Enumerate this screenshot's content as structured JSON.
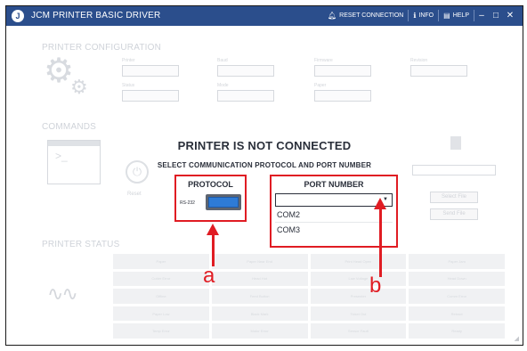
{
  "titlebar": {
    "title": "JCM PRINTER BASIC DRIVER",
    "logo_icon": "jcm-logo-icon",
    "actions": [
      {
        "label": "RESET CONNECTION",
        "icon": "bell-icon"
      },
      {
        "label": "INFO",
        "icon": "info-icon"
      },
      {
        "label": "HELP",
        "icon": "help-book-icon"
      }
    ],
    "window_controls": [
      "minimize-icon",
      "maximize-icon",
      "close-icon"
    ]
  },
  "background": {
    "printer_configuration": {
      "title": "PRINTER CONFIGURATION",
      "field_labels": [
        "Printer",
        "Baud",
        "Firmware",
        "Revision",
        "Status",
        "Mode",
        "Paper"
      ]
    },
    "commands": {
      "title": "COMMANDS",
      "reset_label": "Reset",
      "file_buttons": [
        "Select File",
        "Send File"
      ]
    },
    "printer_status": {
      "title": "PRINTER STATUS",
      "cells": [
        "Paper",
        "Paper Near End",
        "Print Head Open",
        "Paper Jam",
        "Cutter Error",
        "Head Hot",
        "Low Voltage",
        "Head Down",
        "Offline",
        "Feed Button",
        "Presenter",
        "Comm Error",
        "Paper Low",
        "Black Mark",
        "Ticket Out",
        "Retract",
        "Temp Error",
        "Motor Error",
        "Sensor Fault",
        "Ready"
      ]
    }
  },
  "dialog": {
    "title": "PRINTER IS NOT CONNECTED",
    "subtitle": "SELECT COMMUNICATION PROTOCOL AND PORT NUMBER",
    "protocol": {
      "title": "PROTOCOL",
      "option_label": "RS-232",
      "toggle_on": true
    },
    "port": {
      "title": "PORT NUMBER",
      "selected": "",
      "options": [
        "COM2",
        "COM3"
      ]
    }
  },
  "callouts": {
    "a": "a",
    "b": "b"
  },
  "colors": {
    "titlebar": "#2b4e8c",
    "highlight": "#e01c23",
    "toggle": "#2e7bd6"
  }
}
